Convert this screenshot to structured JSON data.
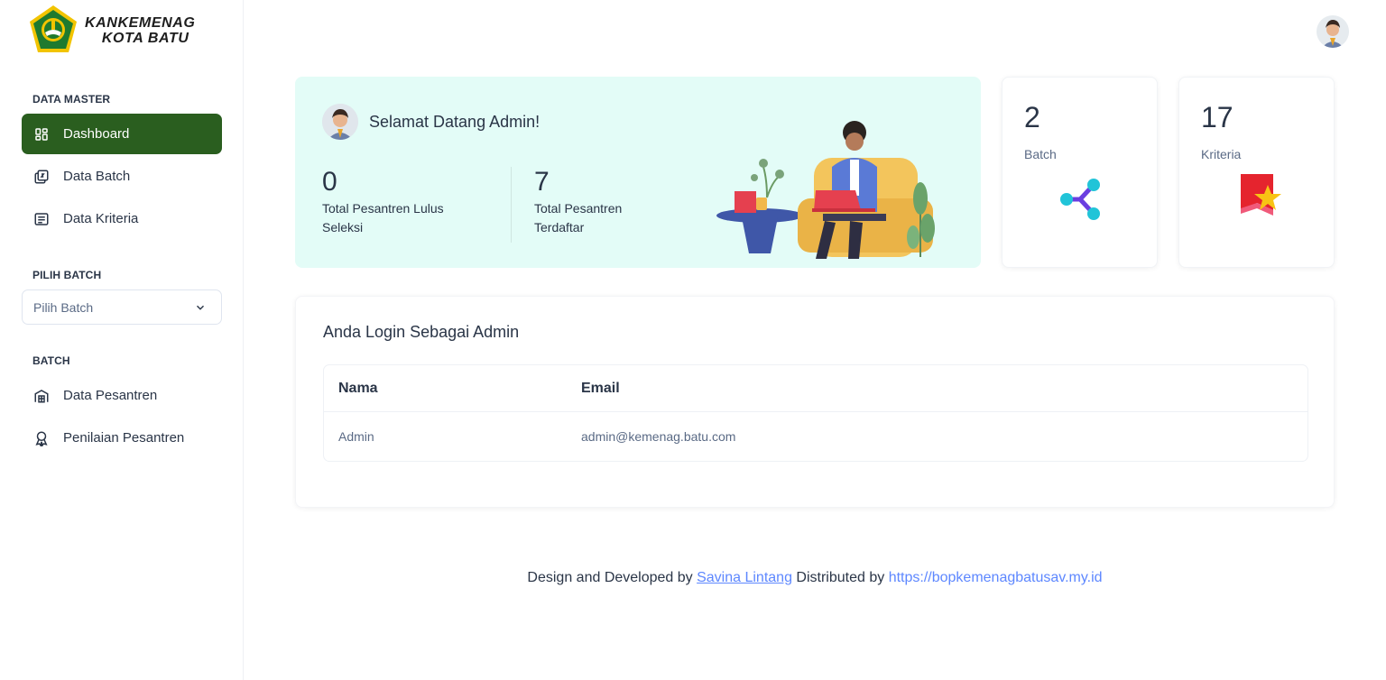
{
  "brand": {
    "line1": "KANKEMENAG",
    "line2": "KOTA BATU"
  },
  "sidebar": {
    "section_master": "DATA MASTER",
    "items_master": [
      {
        "label": "Dashboard",
        "icon": "dashboard-icon",
        "active": true
      },
      {
        "label": "Data Batch",
        "icon": "copy-2-icon"
      },
      {
        "label": "Data Kriteria",
        "icon": "list-details-icon"
      }
    ],
    "section_pilih": "PILIH BATCH",
    "select": {
      "value": "Pilih Batch",
      "icon": "chevron-down-icon"
    },
    "section_batch": "BATCH",
    "items_batch": [
      {
        "label": "Data Pesantren",
        "icon": "building-icon"
      },
      {
        "label": "Penilaian Pesantren",
        "icon": "award-icon"
      }
    ]
  },
  "welcome": {
    "title": "Selamat Datang Admin!",
    "stats": [
      {
        "value": "0",
        "label": "Total Pesantren Lulus Seleksi"
      },
      {
        "value": "7",
        "label": "Total Pesantren Terdaftar"
      }
    ]
  },
  "cards": [
    {
      "value": "2",
      "label": "Batch",
      "icon": "share-network-icon"
    },
    {
      "value": "17",
      "label": "Kriteria",
      "icon": "star-flag-icon"
    }
  ],
  "login": {
    "title": "Anda Login Sebagai Admin",
    "columns": [
      "Nama",
      "Email"
    ],
    "rows": [
      [
        "Admin",
        "admin@kemenag.batu.com"
      ]
    ]
  },
  "footer": {
    "text1": "Design and Developed by",
    "link1": "Savina Lintang",
    "text2": "Distributed by",
    "link2": "https://bopkemenagbatusav.my.id"
  },
  "colors": {
    "accent": "#2a5e1f",
    "welcome_bg": "#e3fcf7",
    "link": "#5d87ff"
  }
}
